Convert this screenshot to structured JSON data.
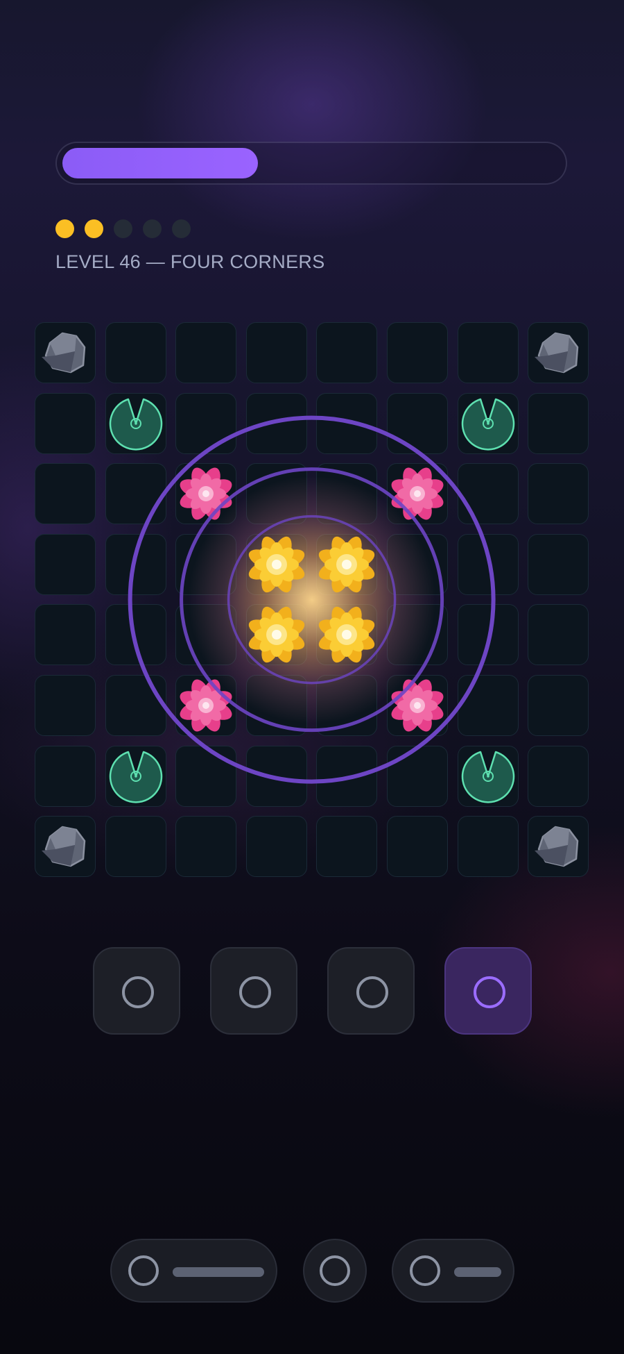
{
  "progress": {
    "fraction": 0.393
  },
  "stars": {
    "earned": 2,
    "total": 5,
    "earned_color": "#fbbf24",
    "empty_color": "#252c37"
  },
  "level": {
    "title": "LEVEL 46 — FOUR CORNERS"
  },
  "board": {
    "rows": 8,
    "cols": 8,
    "pieces": [
      {
        "type": "rock",
        "row": 0,
        "col": 0
      },
      {
        "type": "rock",
        "row": 0,
        "col": 7
      },
      {
        "type": "rock",
        "row": 7,
        "col": 0
      },
      {
        "type": "rock",
        "row": 7,
        "col": 7
      },
      {
        "type": "lily-pad",
        "row": 1,
        "col": 1
      },
      {
        "type": "lily-pad",
        "row": 1,
        "col": 6
      },
      {
        "type": "lily-pad",
        "row": 6,
        "col": 1
      },
      {
        "type": "lily-pad",
        "row": 6,
        "col": 6
      },
      {
        "type": "pink-flower",
        "row": 2,
        "col": 2
      },
      {
        "type": "pink-flower",
        "row": 2,
        "col": 5
      },
      {
        "type": "pink-flower",
        "row": 5,
        "col": 2
      },
      {
        "type": "pink-flower",
        "row": 5,
        "col": 5
      },
      {
        "type": "yellow-flower",
        "row": 3,
        "col": 3
      },
      {
        "type": "yellow-flower",
        "row": 3,
        "col": 4
      },
      {
        "type": "yellow-flower",
        "row": 4,
        "col": 3
      },
      {
        "type": "yellow-flower",
        "row": 4,
        "col": 4
      }
    ],
    "ripple": {
      "center_row": 3.5,
      "center_col": 3.5,
      "rings": 3
    }
  },
  "actions": [
    {
      "icon": "circle-icon",
      "active": false
    },
    {
      "icon": "circle-icon",
      "active": false
    },
    {
      "icon": "circle-icon",
      "active": false
    },
    {
      "icon": "circle-icon",
      "active": true
    }
  ],
  "bottom_bar": [
    {
      "icon": "circle-icon",
      "has_label_bar": true
    },
    {
      "icon": "circle-icon",
      "has_label_bar": false
    },
    {
      "icon": "circle-icon",
      "has_label_bar": true
    }
  ],
  "colors": {
    "accent": "#8b5cf6",
    "tile": "#0c151e",
    "ripple": "#6d45c4",
    "lily": "#5ee0b0",
    "pink": "#ec4899",
    "yellow": "#fbbf24"
  }
}
